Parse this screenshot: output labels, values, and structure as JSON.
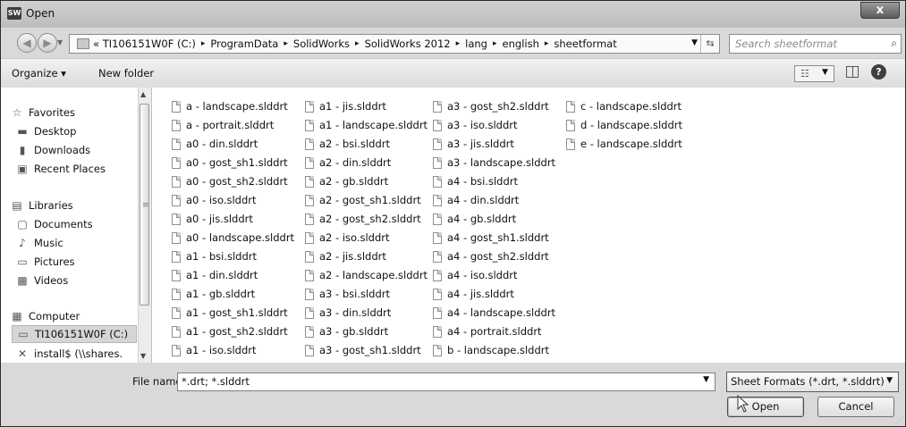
{
  "window": {
    "title": "Open",
    "app_icon": "SW",
    "close_label": "x"
  },
  "address": {
    "crumbs": [
      "« TI106151W0F (C:)",
      "ProgramData",
      "SolidWorks",
      "SolidWorks 2012",
      "lang",
      "english",
      "sheetformat"
    ],
    "separator": "▸"
  },
  "search": {
    "placeholder": "Search sheetformat"
  },
  "toolbar": {
    "organize_label": "Organize ▾",
    "new_folder_label": "New folder"
  },
  "nav": {
    "favorites": "Favorites",
    "desktop": "Desktop",
    "downloads": "Downloads",
    "recent_places": "Recent Places",
    "libraries": "Libraries",
    "documents": "Documents",
    "music": "Music",
    "pictures": "Pictures",
    "videos": "Videos",
    "computer": "Computer",
    "drive_c": "TI106151W0F (C:)",
    "network_share": "install$ (\\\\shares."
  },
  "files": {
    "col1": [
      "a - landscape.slddrt",
      "a - portrait.slddrt",
      "a0 - din.slddrt",
      "a0 - gost_sh1.slddrt",
      "a0 - gost_sh2.slddrt",
      "a0 - iso.slddrt",
      "a0 - jis.slddrt",
      "a0 - landscape.slddrt",
      "a1 - bsi.slddrt",
      "a1 - din.slddrt",
      "a1 - gb.slddrt",
      "a1 - gost_sh1.slddrt",
      "a1 - gost_sh2.slddrt",
      "a1 - iso.slddrt"
    ],
    "col2": [
      "a1 - jis.slddrt",
      "a1 - landscape.slddrt",
      "a2 - bsi.slddrt",
      "a2 - din.slddrt",
      "a2 - gb.slddrt",
      "a2 - gost_sh1.slddrt",
      "a2 - gost_sh2.slddrt",
      "a2 - iso.slddrt",
      "a2 - jis.slddrt",
      "a2 - landscape.slddrt",
      "a3 - bsi.slddrt",
      "a3 - din.slddrt",
      "a3 - gb.slddrt",
      "a3 - gost_sh1.slddrt"
    ],
    "col3": [
      "a3 - gost_sh2.slddrt",
      "a3 - iso.slddrt",
      "a3 - jis.slddrt",
      "a3 - landscape.slddrt",
      "a4 - bsi.slddrt",
      "a4 - din.slddrt",
      "a4 - gb.slddrt",
      "a4 - gost_sh1.slddrt",
      "a4 - gost_sh2.slddrt",
      "a4 - iso.slddrt",
      "a4 - jis.slddrt",
      "a4 - landscape.slddrt",
      "a4 - portrait.slddrt",
      "b - landscape.slddrt"
    ],
    "col4": [
      "c - landscape.slddrt",
      "d - landscape.slddrt",
      "e - landscape.slddrt"
    ]
  },
  "footer": {
    "file_name_label": "File name:",
    "file_name_value": "*.drt; *.slddrt",
    "filter_selected": "Sheet Formats (*.drt, *.slddrt)",
    "open_label": "Open",
    "cancel_label": "Cancel"
  }
}
